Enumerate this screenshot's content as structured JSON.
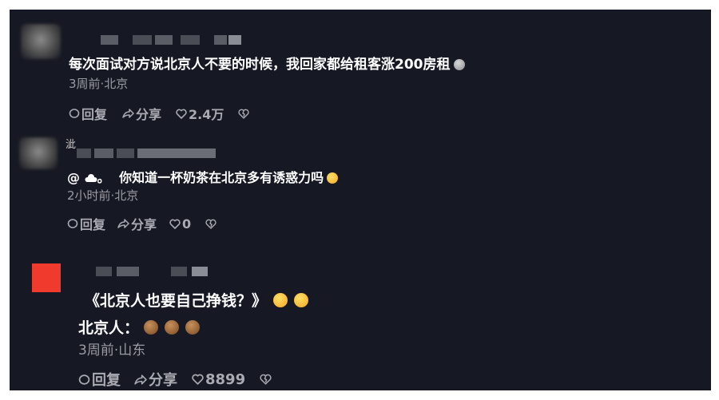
{
  "comments": [
    {
      "text": "每次面试对方说北京人不要的时候，我回家都给租客涨200房租",
      "emoji": "cat-face-emoji",
      "meta": "3周前·北京",
      "reply": "回复",
      "share": "分享",
      "likes": "2.4万"
    },
    {
      "name_fragment": "泚",
      "mention_at": "@",
      "mention_dot": "。",
      "text": "你知道一杯奶茶在北京多有诱惑力吗",
      "emoji": "grinning-emoji",
      "meta": "2小时前·北京",
      "reply": "回复",
      "share": "分享",
      "likes": "0"
    },
    {
      "text": "《北京人也要自己挣钱？》",
      "emojis": [
        "laughing-tears-emoji",
        "laughing-tears-emoji"
      ],
      "text2": "北京人：",
      "emojis2": [
        "money-face-emoji",
        "money-face-emoji",
        "money-face-emoji"
      ],
      "meta": "3周前·山东",
      "reply": "回复",
      "share": "分享",
      "likes": "8899"
    }
  ],
  "colors": {
    "background": "#161823",
    "text": "#ffffff",
    "meta": "#9a9ba3",
    "avatar_red": "#f03a2e"
  }
}
